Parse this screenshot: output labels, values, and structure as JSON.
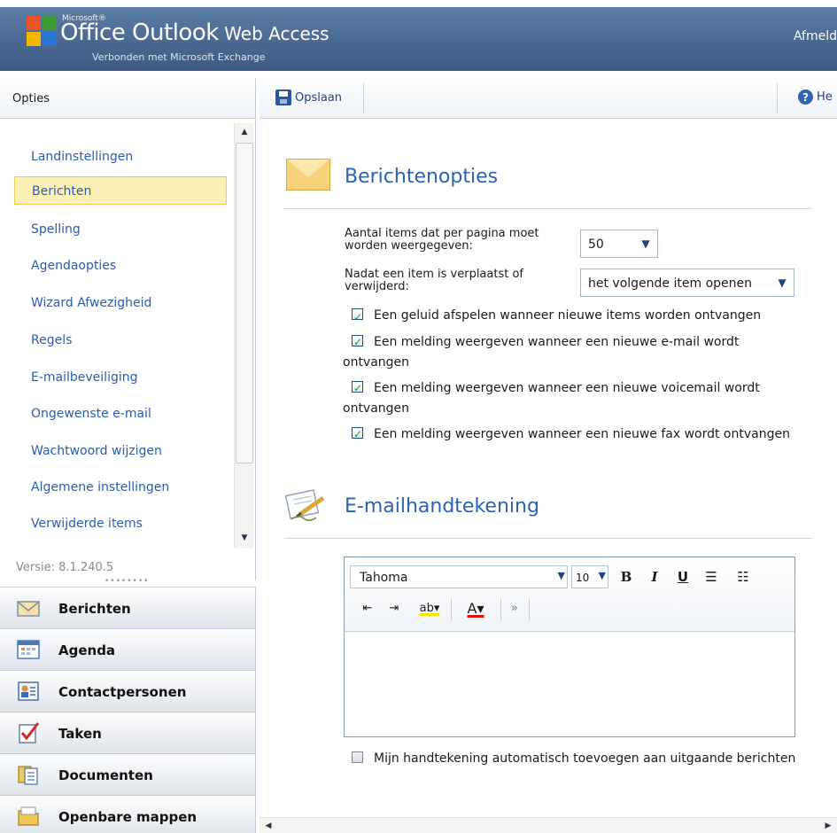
{
  "header": {
    "brand_small": "Microsoft®",
    "title_big": "Office Outlook",
    "title_small": " Web Access",
    "subtitle": "Verbonden met Microsoft Exchange",
    "signout_label": "Afmeld"
  },
  "toolbar": {
    "left_title": "Opties",
    "save_label": "Opslaan",
    "help_label": "He"
  },
  "nav": {
    "items": [
      {
        "label": "Landinstellingen"
      },
      {
        "label": "Berichten"
      },
      {
        "label": "Spelling"
      },
      {
        "label": "Agendaopties"
      },
      {
        "label": "Wizard Afwezigheid"
      },
      {
        "label": "Regels"
      },
      {
        "label": "E-mailbeveiliging"
      },
      {
        "label": "Ongewenste e-mail"
      },
      {
        "label": "Wachtwoord wijzigen"
      },
      {
        "label": "Algemene instellingen"
      },
      {
        "label": "Verwijderde items"
      }
    ],
    "selected": "Berichten",
    "version": "Versie: 8.1.240.5"
  },
  "modules": [
    {
      "label": "Berichten",
      "icon": "mail-icon"
    },
    {
      "label": "Agenda",
      "icon": "calendar-icon"
    },
    {
      "label": "Contactpersonen",
      "icon": "contacts-icon"
    },
    {
      "label": "Taken",
      "icon": "tasks-icon"
    },
    {
      "label": "Documenten",
      "icon": "documents-icon"
    },
    {
      "label": "Openbare mappen",
      "icon": "folder-icon"
    }
  ],
  "message_options": {
    "title": "Berichtenopties",
    "items_per_page_label": "Aantal items dat per pagina moet worden weergegeven:",
    "items_per_page_value": "50",
    "after_move_label": "Nadat een item is verplaatst of verwijderd:",
    "after_move_value": "het volgende item openen",
    "checkboxes": [
      {
        "label": "Een geluid afspelen wanneer nieuwe items worden ontvangen",
        "checked": true
      },
      {
        "label": "Een melding weergeven wanneer een nieuwe e-mail wordt ontvangen",
        "checked": true
      },
      {
        "label": "Een melding weergeven wanneer een nieuwe voicemail wordt ontvangen",
        "checked": true
      },
      {
        "label": "Een melding weergeven wanneer een nieuwe fax wordt ontvangen",
        "checked": true
      }
    ]
  },
  "signature": {
    "title": "E-mailhandtekening",
    "font": "Tahoma",
    "size": "10",
    "bold": "B",
    "italic": "I",
    "underline": "U",
    "auto_add_label": "Mijn handtekening automatisch toevoegen aan uitgaande berichten",
    "auto_add_checked": false
  },
  "colors": {
    "header": "#4a6890",
    "accent_link": "#2a5cb0",
    "selected_bg": "#fef1b8",
    "title_blue": "#2a62b5"
  }
}
